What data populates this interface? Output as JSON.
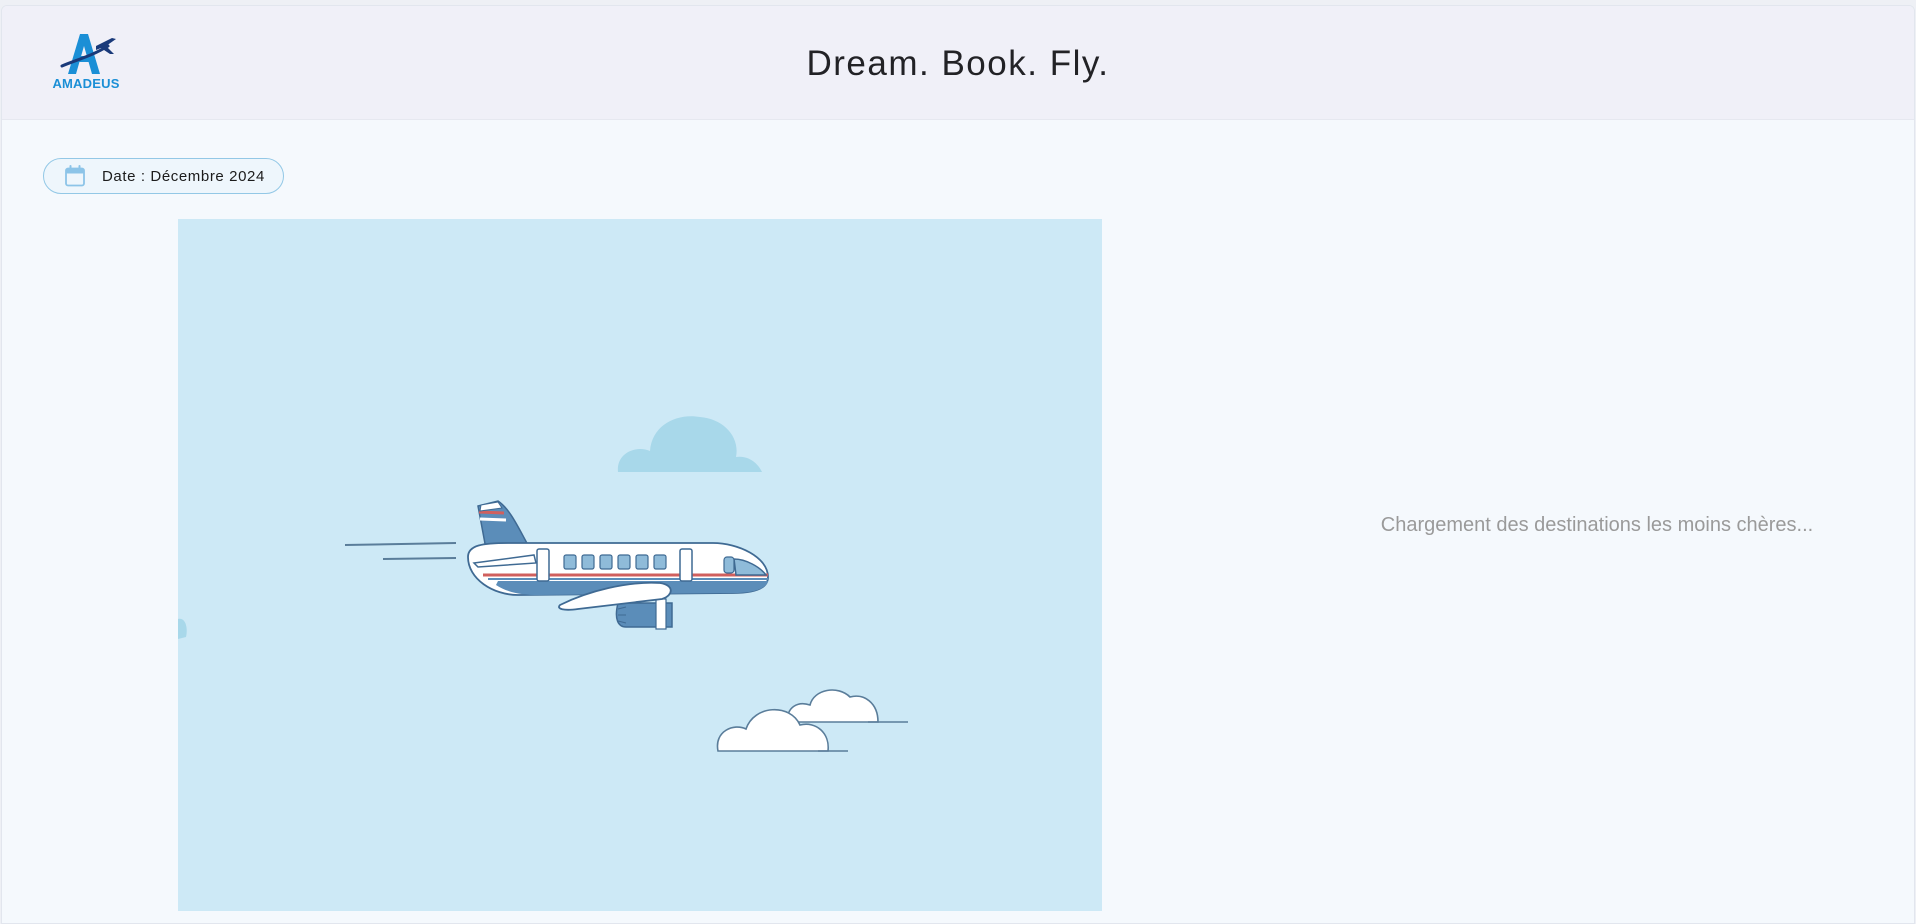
{
  "header": {
    "logo_text": "AMADEUS",
    "title": "Dream. Book. Fly."
  },
  "date_chip": {
    "icon": "calendar-icon",
    "label": "Date : Décembre 2024"
  },
  "illustration": {
    "subject": "airplane-in-sky"
  },
  "status": {
    "loading_text": "Chargement des destinations les moins chères..."
  },
  "colors": {
    "brand_blue": "#1b8fd6",
    "header_bg": "#f0f0f8",
    "sky": "#cde9f6",
    "plane_blue": "#5b8db9",
    "stripe_red": "#d0605e"
  }
}
